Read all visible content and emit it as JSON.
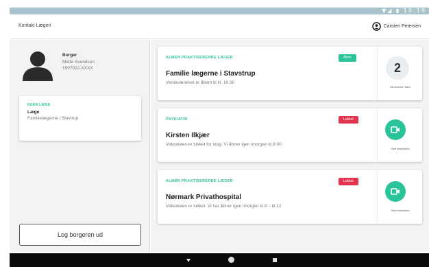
{
  "statusbar": {
    "icons": "▼◢ ▮ 10:19"
  },
  "header": {
    "title": "Kontakt Lægen",
    "user_name": "Carsten Petersen"
  },
  "citizen": {
    "label": "Borger",
    "name": "Mette Svendsen",
    "cpr": "1507022-XXXX"
  },
  "own_doctor": {
    "tag": "EGEN LÆGE",
    "label": "Læge",
    "name": "Familielægerne i Stavtrup"
  },
  "logout_label": "Log borgeren ud",
  "cards": [
    {
      "category": "ALMEN PRAKTISERENDE LÆGER",
      "status": "Åben",
      "name": "Familie lægerne i Stavstrup",
      "description": "Venteværelset er åbent til kl. 16:30",
      "queue_count": "2",
      "side_caption": "Din nummer i køen"
    },
    {
      "category": "PSYKIATRI",
      "status": "Lukket",
      "name": "Kirsten Ilkjær",
      "description": "Videokøen er lukket for idag. Vi åbner igen imorgen kl.8:00",
      "side_caption": "Start konsultation"
    },
    {
      "category": "ALMEN PRAKTISERENDE LÆGER",
      "status": "Lukket",
      "name": "Nørmark Privathospital",
      "description": "Videokøen er lukket. Vi har åbner igen imorgen kl.8 – kl.12",
      "side_caption": "Start konsultation"
    }
  ],
  "colors": {
    "accent": "#2ac39a",
    "closed": "#e2344f",
    "statusbar": "#a9c3cc"
  }
}
